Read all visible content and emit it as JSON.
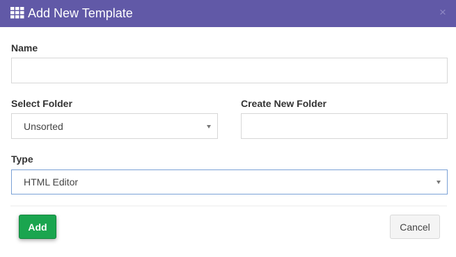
{
  "header": {
    "title": "Add New Template",
    "icon": "grid-icon",
    "close_label": "×",
    "background_color": "#6159a7"
  },
  "form": {
    "name": {
      "label": "Name",
      "value": ""
    },
    "select_folder": {
      "label": "Select Folder",
      "value": "Unsorted"
    },
    "create_new_folder": {
      "label": "Create New Folder",
      "value": ""
    },
    "type": {
      "label": "Type",
      "value": "HTML Editor"
    }
  },
  "footer": {
    "add_label": "Add",
    "cancel_label": "Cancel",
    "add_color": "#1aa54f"
  }
}
